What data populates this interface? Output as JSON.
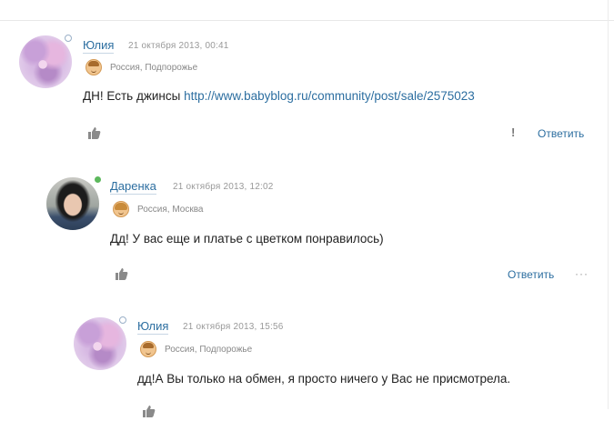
{
  "comments": [
    {
      "author": "Юлия",
      "date": "21 октября 2013, 00:41",
      "location": "Россия, Подпорожье",
      "text_prefix": "ДН! Есть джинсы ",
      "link": "http://www.babyblog.ru/community/post/sale/2575023",
      "reply_label": "Ответить",
      "report_label": "!"
    },
    {
      "author": "Даренка",
      "date": "21 октября 2013, 12:02",
      "location": "Россия, Москва",
      "text": "Дд! У вас еще и платье с цветком понравилось)",
      "reply_label": "Ответить",
      "more_label": "···"
    },
    {
      "author": "Юлия",
      "date": "21 октября 2013, 15:56",
      "location": "Россия, Подпорожье",
      "text": "дд!А Вы только на обмен, я просто ничего у Вас не присмотрела."
    }
  ],
  "icons": {
    "like": "thumbs-up-icon",
    "status_clock": "clock-icon",
    "status_online": "online-dot-icon",
    "avatar_boy": "boy-avatar-icon",
    "avatar_girl": "girl-avatar-icon"
  },
  "colors": {
    "link": "#2c6ea0",
    "meta": "#999999",
    "online": "#5cb85c"
  }
}
